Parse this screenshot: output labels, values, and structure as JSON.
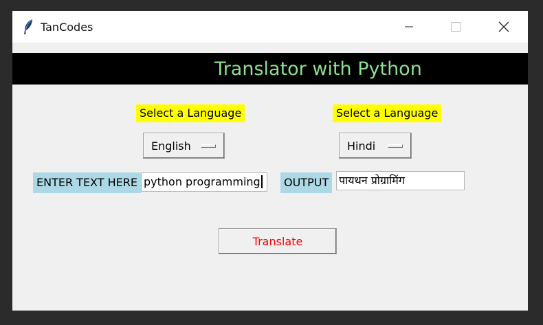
{
  "window": {
    "title": "TanCodes",
    "icon": "feather-icon",
    "controls": [
      "minimize-icon",
      "maximize-icon",
      "close-icon"
    ]
  },
  "header": {
    "title": "Translator with Python",
    "background": "#000000",
    "color": "#8fe08f"
  },
  "source": {
    "language_prompt": "Select a Language",
    "selected_language": "English",
    "input_label": "ENTER TEXT HERE",
    "input_value": "python programming"
  },
  "target": {
    "language_prompt": "Select a Language",
    "selected_language": "Hindi",
    "output_label": "OUTPUT",
    "output_value": "पायथन प्रोग्रामिंग"
  },
  "actions": {
    "translate_label": "Translate",
    "translate_color": "#ff0000"
  },
  "colors": {
    "prompt_background": "#ffff00",
    "field_label_background": "#add8e6",
    "window_background": "#f0f0f0"
  }
}
